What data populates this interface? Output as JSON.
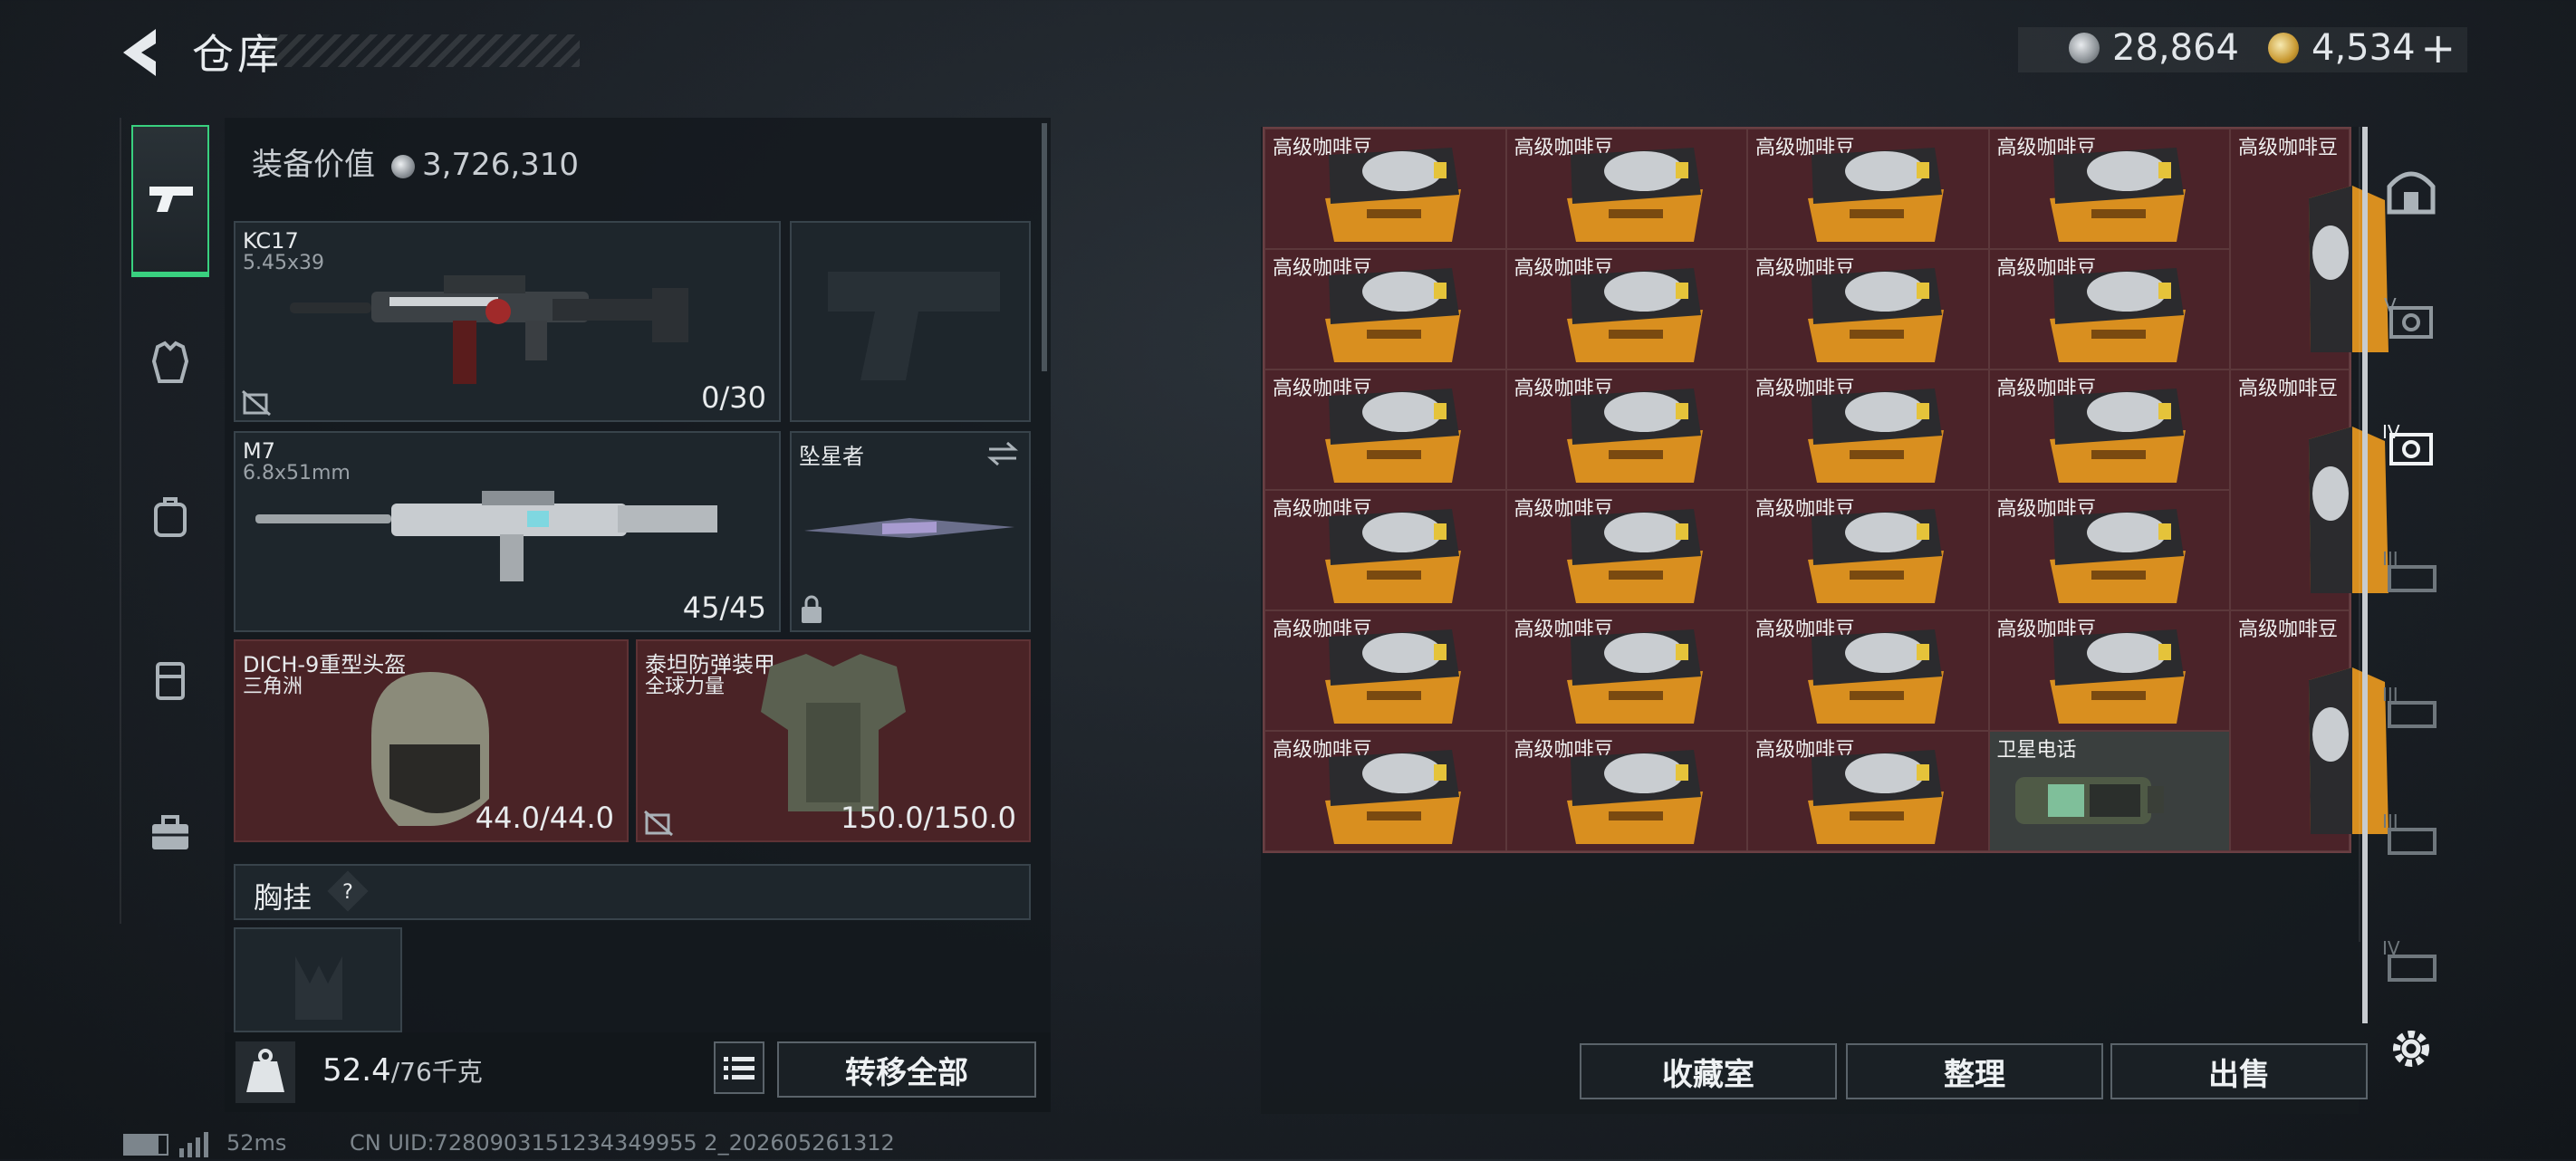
{
  "header": {
    "title": "仓库",
    "currency1": "28,864",
    "currency2": "4,534",
    "plus": "+"
  },
  "equipment": {
    "label": "装备价值",
    "value": "3,726,310",
    "primary": {
      "name": "KC17",
      "caliber": "5.45x39",
      "ammo": "0/30"
    },
    "secondary": {
      "name": "M7",
      "caliber": "6.8x51mm",
      "ammo": "45/45"
    },
    "melee": {
      "name": "坠星者"
    },
    "helmet": {
      "name": "DICH-9重型头盔",
      "brand": "三角洲",
      "durability": "44.0/44.0"
    },
    "armor": {
      "name": "泰坦防弹装甲",
      "brand": "全球力量",
      "durability": "150.0/150.0"
    },
    "vest": {
      "label": "胸挂",
      "help": "?"
    }
  },
  "footer": {
    "weight": "52.4",
    "weight_max": "/76千克",
    "transfer_all": "转移全部"
  },
  "stash": {
    "item_name": "高级咖啡豆",
    "phone_name": "卫星电话",
    "buttons": {
      "collection": "收藏室",
      "sort": "整理",
      "sell": "出售"
    }
  },
  "status": {
    "ping": "52ms",
    "uid": "CN UID:7280903151234349955 2_202605261312"
  },
  "colors": {
    "accent": "#39d07f",
    "item_bg": "#4b2329",
    "panel": "#1e262c"
  }
}
